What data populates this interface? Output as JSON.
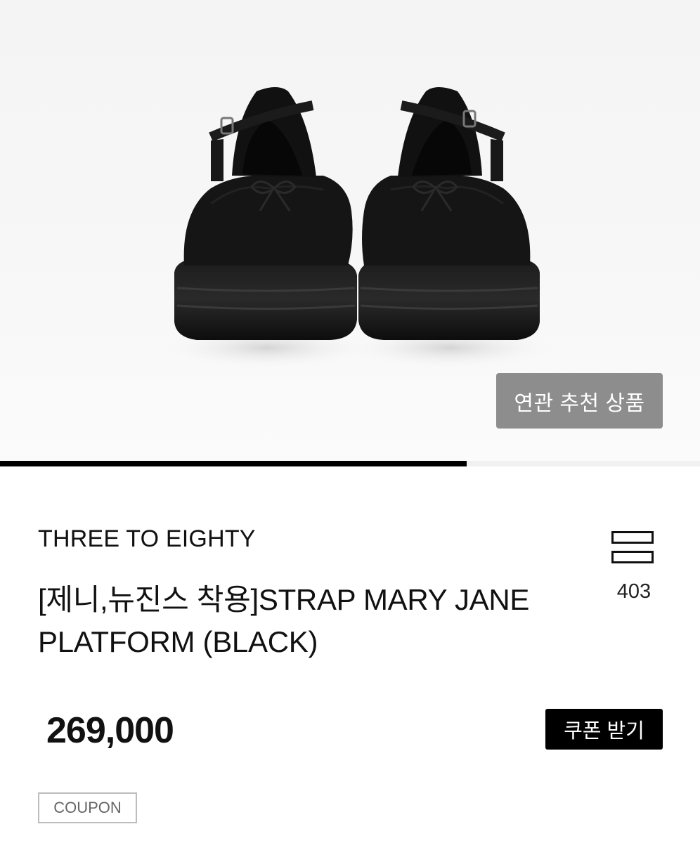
{
  "hero": {
    "image_alt": "product-photo",
    "related_button_label": "연관 추천 상품",
    "slide_progress": 0.667
  },
  "product": {
    "brand": "THREE TO EIGHTY",
    "title": "[제니,뉴진스 착용]STRAP MARY JANE PLATFORM (BLACK)",
    "like_count": "403",
    "price": "269,000",
    "coupon_button_label": "쿠폰 받기",
    "coupon_tag": "COUPON"
  },
  "icons": {
    "like": "bookmark-bars-icon"
  },
  "colors": {
    "accent": "#000000",
    "related_button_bg": "#8d8d8d",
    "tag_border": "#bdbdbd"
  }
}
